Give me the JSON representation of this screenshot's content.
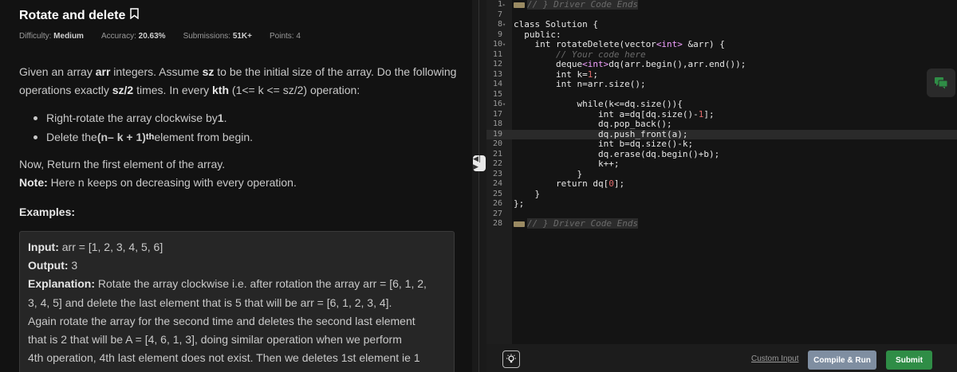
{
  "problem": {
    "title": "Rotate and delete",
    "meta": {
      "difficulty_label": "Difficulty:",
      "difficulty": "Medium",
      "accuracy_label": "Accuracy:",
      "accuracy": "20.63%",
      "submissions_label": "Submissions:",
      "submissions": "51K+",
      "points": "Points: 4"
    },
    "desc1": {
      "a": "Given an array ",
      "b": "arr",
      "c": " integers. Assume ",
      "d": "sz",
      "e": " to be the initial size of the array. Do the following"
    },
    "desc2": {
      "a": "operations exactly ",
      "b": "sz/2",
      "c": " times. In every ",
      "d": "kth",
      "e": " (1<= k <= sz/2) operation:"
    },
    "bullet1": {
      "a": "Right-rotate the array clockwise by ",
      "b": "1",
      "c": "."
    },
    "bullet2": {
      "a": "Delete the ",
      "b": "(n– k + 1)",
      "sup": "th",
      "c": " element from begin."
    },
    "return_text": "Now, Return the first element of the array.",
    "note": {
      "label": "Note:",
      "text": " Here n keeps on decreasing with every operation."
    },
    "examples_heading": "Examples:",
    "example": {
      "input_label": "Input:",
      "input": " arr = [1, 2, 3, 4, 5, 6]",
      "output_label": "Output:",
      "output": " 3",
      "explanation_label": "Explanation:",
      "lines": [
        " Rotate the array clockwise i.e. after rotation the array arr = [6, 1, 2,",
        "3, 4, 5] and delete the last element that is 5 that will be arr = [6, 1, 2, 3, 4].",
        "Again rotate the array for the second time and deletes the second last element",
        "that is 2 that will be A = [4, 6, 1, 3], doing similar operation when we perform",
        "4th operation, 4th last element does not exist. Then we deletes 1st element ie 1"
      ]
    }
  },
  "editor": {
    "collapsed_top": "// } Driver Code Ends",
    "collapsed_bottom": "// } Driver Code Ends",
    "lines": [
      {
        "n": "1",
        "t": ""
      },
      {
        "n": "7",
        "t": ""
      },
      {
        "n": "8",
        "t": "class Solution {"
      },
      {
        "n": "9",
        "t": "  public:"
      },
      {
        "n": "10",
        "t": "    int rotateDelete(vector<int> &arr) {"
      },
      {
        "n": "11",
        "t": "        // Your code here"
      },
      {
        "n": "12",
        "t": "        deque<int>dq(arr.begin(),arr.end());"
      },
      {
        "n": "13",
        "t": "        int k=1;"
      },
      {
        "n": "14",
        "t": "        int n=arr.size();"
      },
      {
        "n": "15",
        "t": ""
      },
      {
        "n": "16",
        "t": "            while(k<=dq.size()){"
      },
      {
        "n": "17",
        "t": "                int a=dq[dq.size()-1];"
      },
      {
        "n": "18",
        "t": "                dq.pop_back();"
      },
      {
        "n": "19",
        "t": "                dq.push_front(a);"
      },
      {
        "n": "20",
        "t": "                int b=dq.size()-k;"
      },
      {
        "n": "21",
        "t": "                dq.erase(dq.begin()+b);"
      },
      {
        "n": "22",
        "t": "                k++;"
      },
      {
        "n": "23",
        "t": "            }"
      },
      {
        "n": "24",
        "t": "        return dq[0];"
      },
      {
        "n": "25",
        "t": "    }"
      },
      {
        "n": "26",
        "t": "};"
      },
      {
        "n": "27",
        "t": ""
      },
      {
        "n": "28",
        "t": ""
      }
    ]
  },
  "buttons": {
    "custom_input": "Custom Input",
    "compile_run": "Compile & Run",
    "submit": "Submit"
  },
  "colors": {
    "submit": "#2f8d46",
    "compile": "#7f8ea1",
    "chat_icon": "#2f8d46"
  },
  "icons": [
    "bookmark-icon",
    "drag-handle-icon",
    "chat-icon",
    "hint-bulb-icon"
  ]
}
